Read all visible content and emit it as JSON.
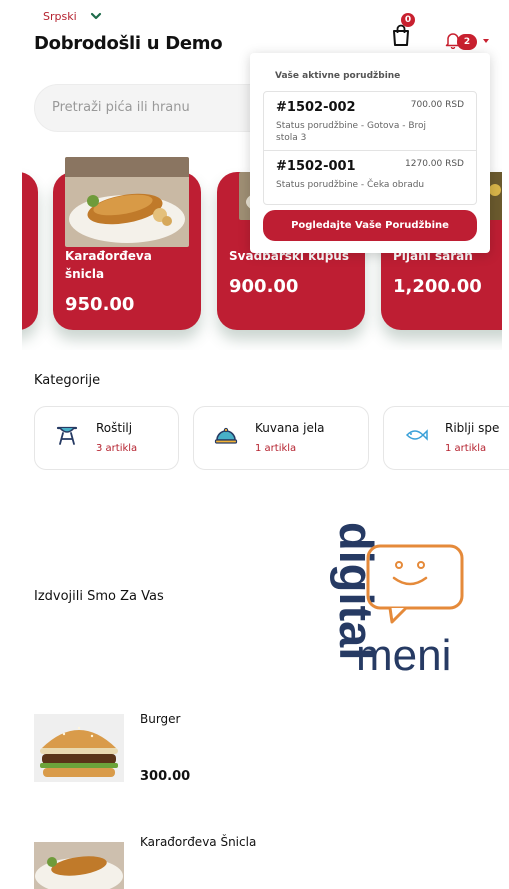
{
  "header": {
    "language": "Srpski",
    "welcome": "Dobrodošli u Demo",
    "cart_count": "0",
    "notif_count": "2"
  },
  "search": {
    "placeholder": "Pretraži pića ili hranu"
  },
  "featured": [
    {
      "name": "Karađorđeva šnicla",
      "price": "950.00"
    },
    {
      "name": "Svadbarski kupus",
      "price": "900.00"
    },
    {
      "name": "Pijani šaran",
      "price": "1,200.00"
    }
  ],
  "orders_dropdown": {
    "title": "Vaše aktivne porudžbine",
    "orders": [
      {
        "id": "#1502-002",
        "amount": "700.00 RSD",
        "status": "Status porudžbine - Gotova - Broj stola 3"
      },
      {
        "id": "#1502-001",
        "amount": "1270.00 RSD",
        "status": "Status porudžbine - Čeka obradu"
      }
    ],
    "button": "Pogledajte Vaše Porudžbine"
  },
  "categories_title": "Kategorije",
  "categories": [
    {
      "name": "Roštilj",
      "count": "3 artikla",
      "icon": "grill-icon"
    },
    {
      "name": "Kuvana jela",
      "count": "1 artikla",
      "icon": "cloche-icon"
    },
    {
      "name": "Riblji spe",
      "count": "1 artikla",
      "icon": "fish-icon"
    }
  ],
  "featured_for_you_title": "Izdvojili Smo Za Vas",
  "logo": {
    "top": "digital",
    "bottom": "meni"
  },
  "items": [
    {
      "name": "Burger",
      "price": "300.00"
    },
    {
      "name": "Karađorđeva Šnicla",
      "price": ""
    }
  ],
  "colors": {
    "brand": "#be1e33",
    "logo_blue": "#263a63",
    "logo_orange": "#e58a3a"
  }
}
